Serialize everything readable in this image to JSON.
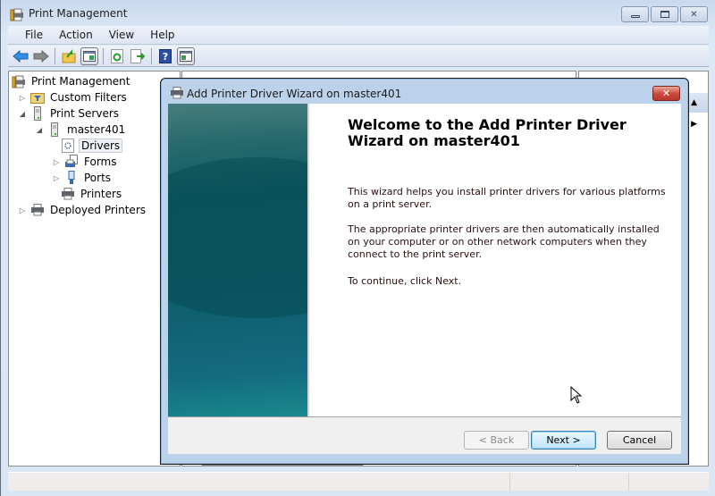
{
  "window": {
    "title": "Print Management",
    "controls": {
      "minimize": "—",
      "maximize": "□",
      "close": "✕"
    }
  },
  "menubar": [
    "File",
    "Action",
    "View",
    "Help"
  ],
  "toolbar": {
    "buttons": [
      "back-icon",
      "forward-icon",
      "up-folder-icon",
      "show-hide-console-tree-icon",
      "refresh-icon",
      "export-list-icon",
      "help-icon",
      "show-hide-action-pane-icon"
    ]
  },
  "tree": {
    "items": [
      {
        "label": "Print Management",
        "icon": "print-management-icon",
        "expander": ""
      },
      {
        "label": "Custom Filters",
        "icon": "filter-folder-icon",
        "expander": "▷"
      },
      {
        "label": "Print Servers",
        "icon": "server-icon",
        "expander": "◢"
      },
      {
        "label": "master401",
        "icon": "server-icon",
        "expander": "◢"
      },
      {
        "label": "Drivers",
        "icon": "drivers-icon",
        "expander": "",
        "selected": true
      },
      {
        "label": "Forms",
        "icon": "forms-icon",
        "expander": "▷"
      },
      {
        "label": "Ports",
        "icon": "ports-icon",
        "expander": "▷"
      },
      {
        "label": "Printers",
        "icon": "printer-icon",
        "expander": ""
      },
      {
        "label": "Deployed Printers",
        "icon": "printer-icon",
        "expander": "▷"
      }
    ]
  },
  "actions_pane": {
    "collapse_arrow": "▲",
    "more_arrow": "▶"
  },
  "wizard": {
    "title": "Add Printer Driver Wizard on master401",
    "close": "✕",
    "heading": "Welcome to the Add Printer Driver Wizard on master401",
    "paragraphs": [
      "This wizard helps you install printer drivers for various platforms on a print server.",
      "The appropriate printer drivers are then automatically installed on your computer or on other network computers when they connect to the print server.",
      "To continue, click Next."
    ],
    "buttons": {
      "back": "< Back",
      "next": "Next >",
      "cancel": "Cancel"
    },
    "back_enabled": false
  }
}
